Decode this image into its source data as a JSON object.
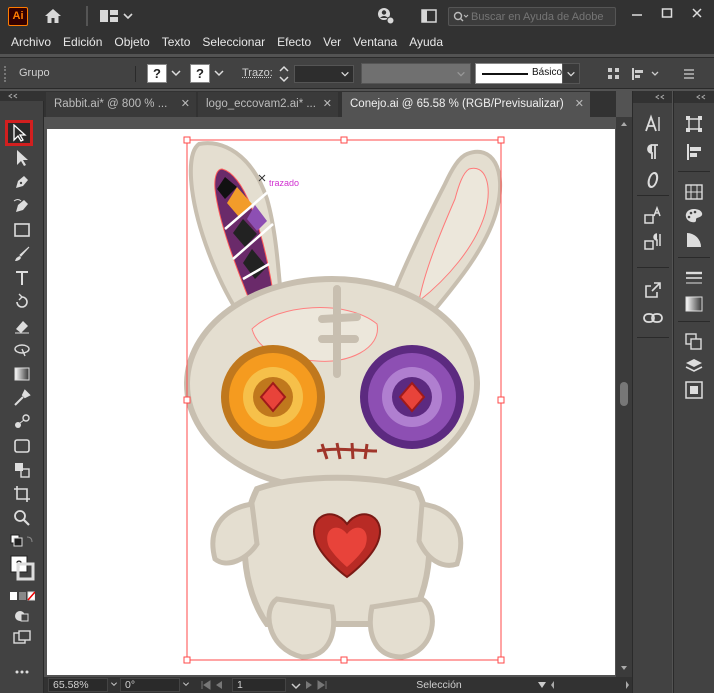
{
  "app": {
    "logo_text": "Ai"
  },
  "search": {
    "placeholder": "Buscar en Ayuda de Adobe"
  },
  "menu": [
    "Archivo",
    "Edición",
    "Objeto",
    "Texto",
    "Seleccionar",
    "Efecto",
    "Ver",
    "Ventana",
    "Ayuda"
  ],
  "control": {
    "selection_type": "Grupo",
    "fill_value": "?",
    "stroke_value": "?",
    "stroke_label": "Trazo:",
    "brush_label": "Básico"
  },
  "tabs": [
    {
      "label": "Rabbit.ai* @ 800 % ...",
      "active": false
    },
    {
      "label": "logo_eccovam2.ai* ...",
      "active": false
    },
    {
      "label": "Conejo.ai @ 65.58 % (RGB/Previsualizar)",
      "active": true
    }
  ],
  "canvas": {
    "hover_label": "trazado"
  },
  "status": {
    "zoom": "65.58%",
    "rotation": "0°",
    "artboard": "1",
    "tool_name": "Selección"
  },
  "colors": {
    "accent_selection": "#d21f1f",
    "path_outline": "#ff4a4a",
    "bunny_body": "#e4ded0",
    "bunny_outline": "#c8bfb0",
    "left_eye": "#f59b1f",
    "right_eye": "#8d4fb3"
  }
}
